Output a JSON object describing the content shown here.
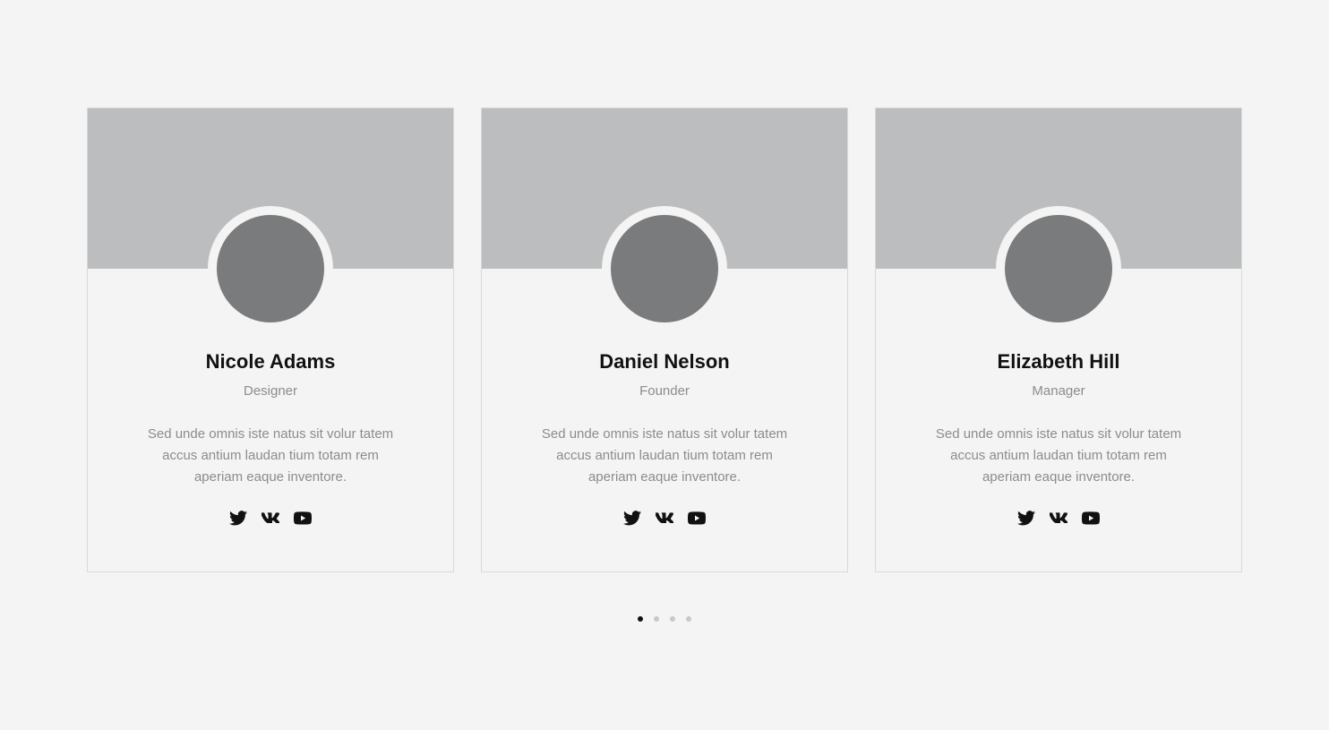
{
  "cards": [
    {
      "name": "Nicole Adams",
      "role": "Designer",
      "text": "Sed unde omnis iste natus sit volur tatem accus antium laudan tium totam rem aperiam eaque inventore.",
      "socials": [
        "twitter-icon",
        "vk-icon",
        "youtube-icon"
      ]
    },
    {
      "name": "Daniel Nelson",
      "role": "Founder",
      "text": "Sed unde omnis iste natus sit volur tatem accus antium laudan tium totam rem aperiam eaque inventore.",
      "socials": [
        "twitter-icon",
        "vk-icon",
        "youtube-icon"
      ]
    },
    {
      "name": "Elizabeth Hill",
      "role": "Manager",
      "text": "Sed unde omnis iste natus sit volur tatem accus antium laudan tium totam rem aperiam eaque inventore.",
      "socials": [
        "twitter-icon",
        "vk-icon",
        "youtube-icon"
      ]
    }
  ],
  "pagination": {
    "total": 4,
    "active": 1
  },
  "colors": {
    "background": "#f4f4f4",
    "banner": "#bcbdbe",
    "avatar": "#7a7b7c",
    "muted_text": "#8c8c8c",
    "dot_active": "#111111",
    "dot_inactive": "#c8c8c8"
  }
}
